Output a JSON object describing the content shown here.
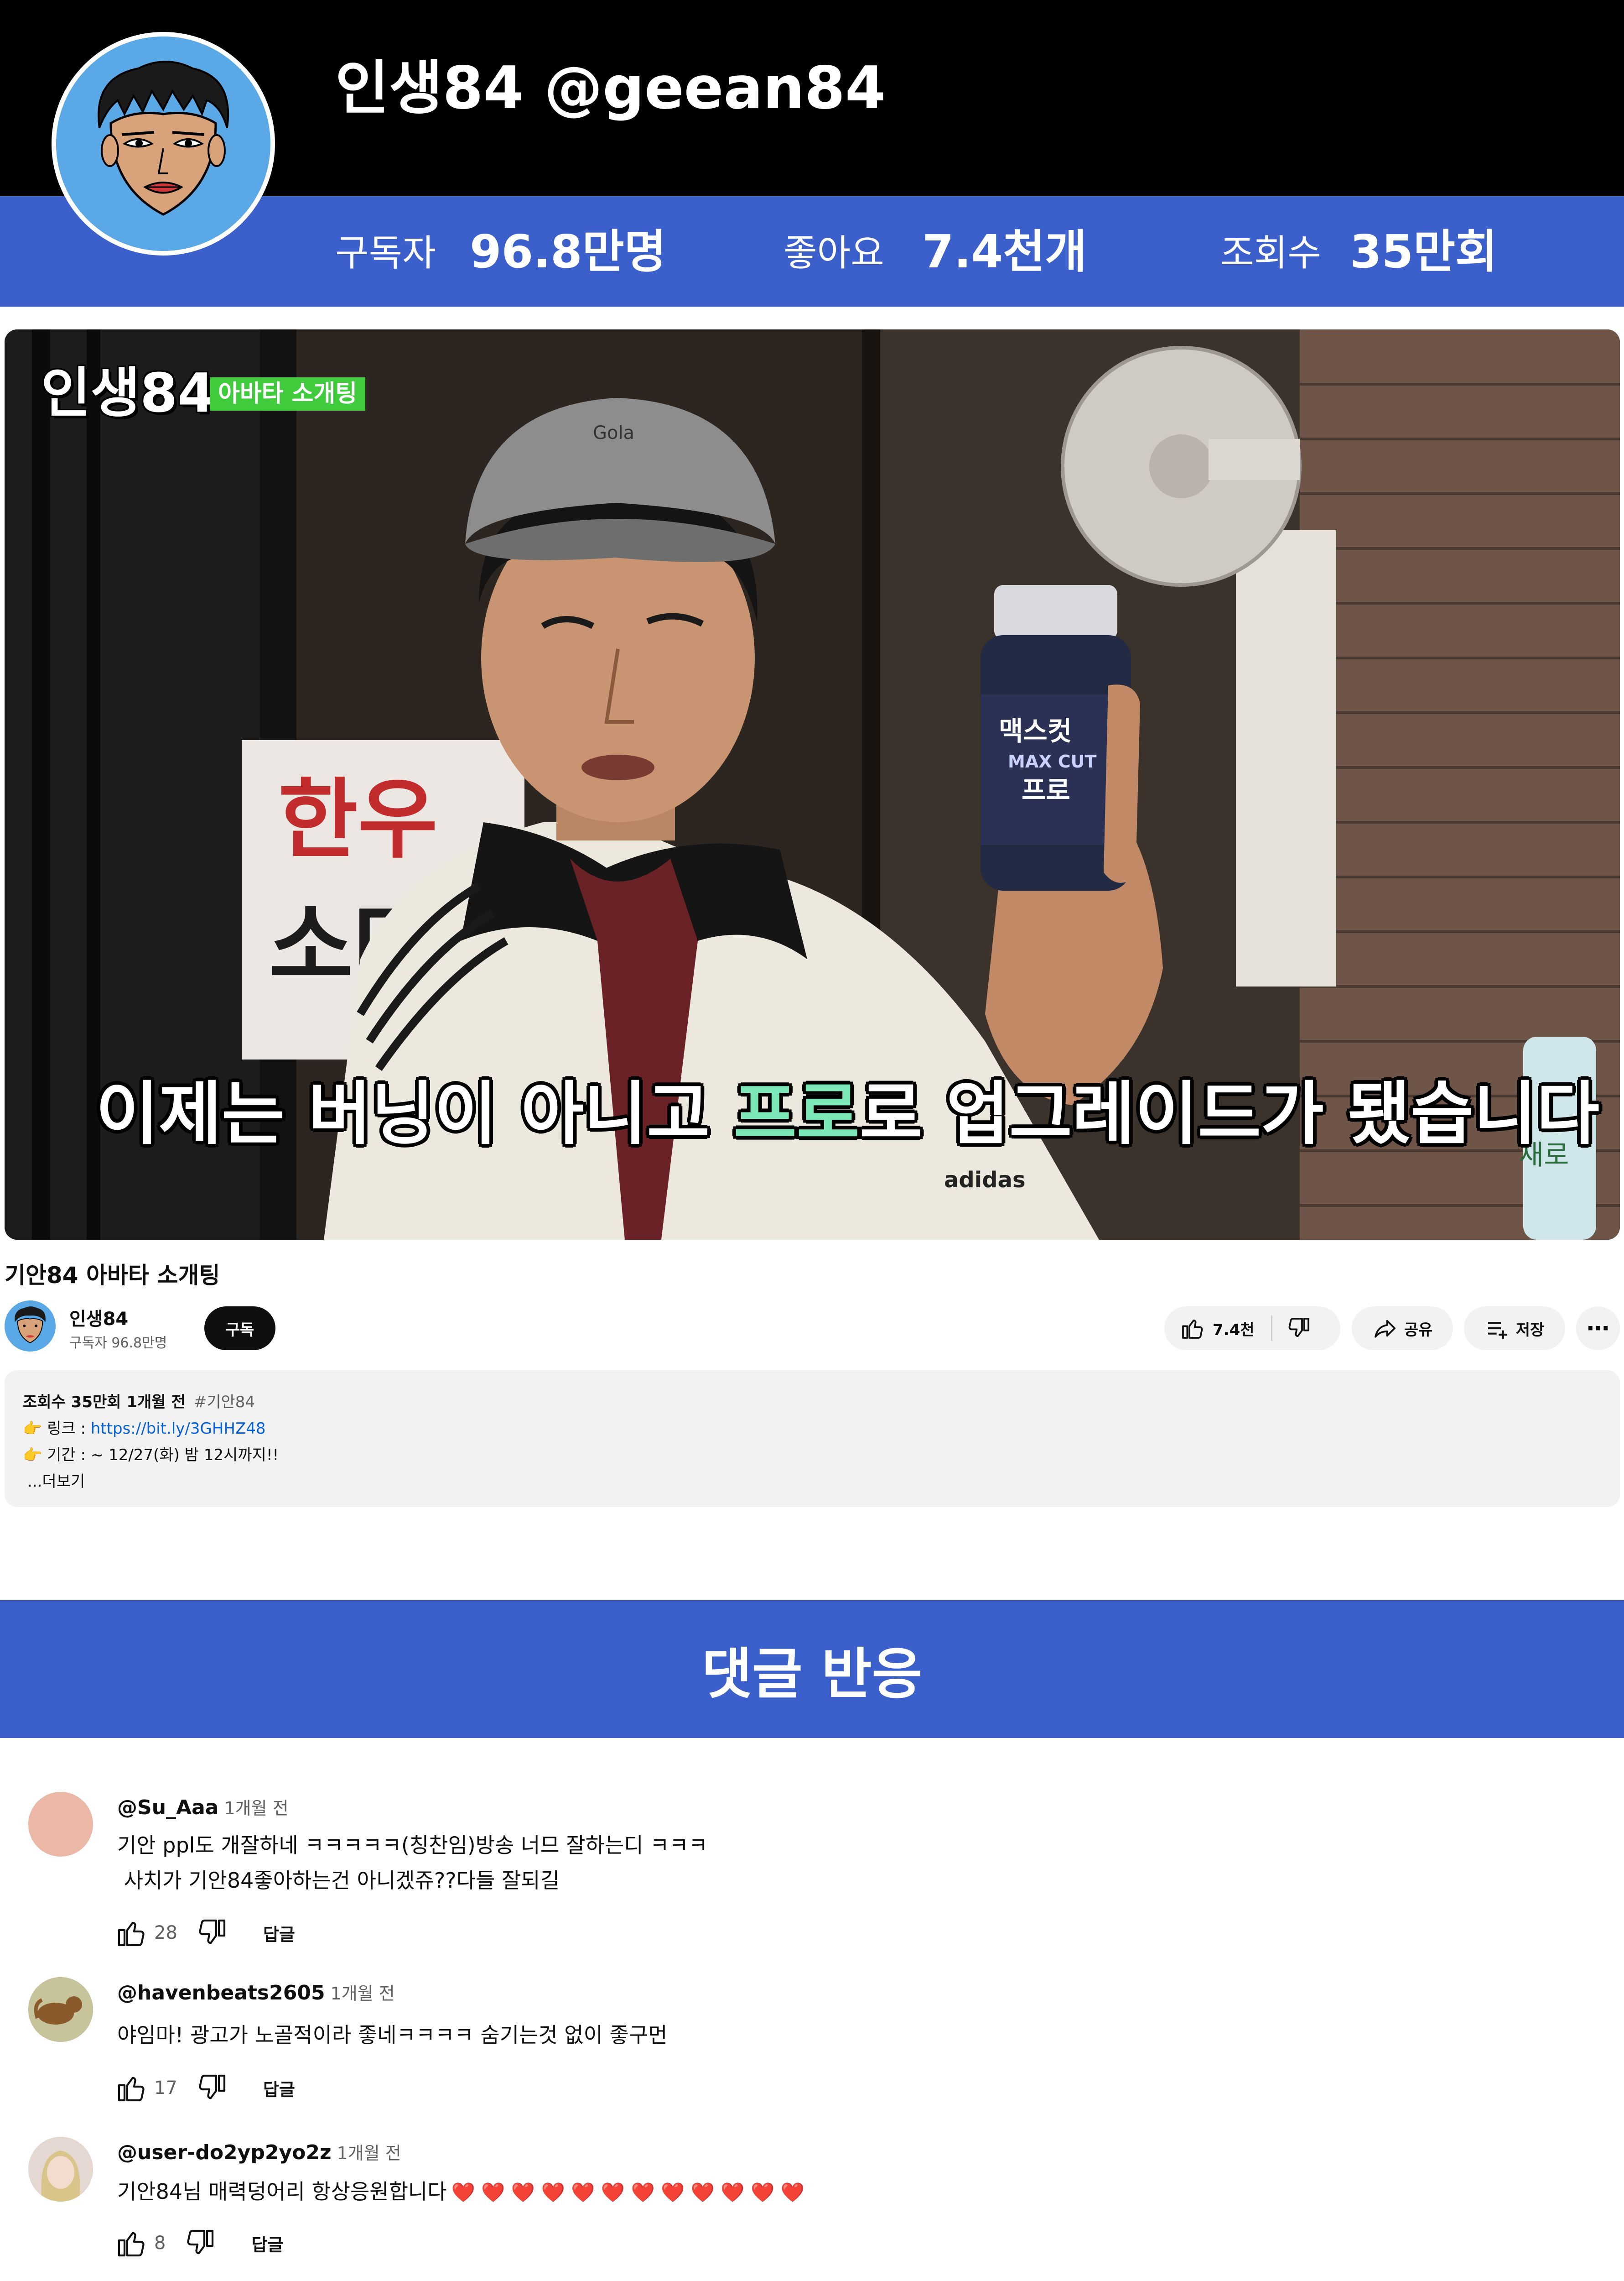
{
  "header": {
    "channel_title": "인생84 @geean84",
    "stats": [
      {
        "label": "구독자",
        "value": "96.8만명"
      },
      {
        "label": "좋아요",
        "value": "7.4천개"
      },
      {
        "label": "조회수",
        "value": "35만회"
      }
    ]
  },
  "video": {
    "logo": "인생84",
    "tag": "아바타 소개팅",
    "subtitle_before": "이제는 버닝이 아니고 ",
    "subtitle_highlight": "프로",
    "subtitle_after": "로 업그레이드가 됐습니다",
    "product_label_1": "맥스컷",
    "product_label_2": "MAX CUT",
    "product_label_3": "프로",
    "shirt_brand": "adidas",
    "sign_left": "한우",
    "sign_left_2": "소머",
    "sign_right": "새로"
  },
  "meta": {
    "title": "기안84 아바타 소개팅",
    "channel_name": "인생84",
    "subscribers": "구독자 96.8만명",
    "subscribe_label": "구독",
    "like_count": "7.4천",
    "share_label": "공유",
    "save_label": "저장",
    "more_label": "⋯"
  },
  "description": {
    "views_line": "조회수 35만회  1개월 전",
    "hashtag": "#기안84",
    "link_label": "👉 링크 : ",
    "link_url": "https://bit.ly/3GHHZ48",
    "period_line": "👉 기간 :  ~ 12/27(화) 밤 12시까지!!",
    "more": "...더보기"
  },
  "comments_banner": "댓글 반응",
  "comments": [
    {
      "author": "@Su_Aaa",
      "time": "1개월 전",
      "lines": [
        "기안 ppl도 개잘하네 ㅋㅋㅋㅋㅋ(칭찬임)방송 너므 잘하는디 ㅋㅋㅋ",
        " 사치가 기안84좋아하는건 아니겠쥬??다들 잘되길"
      ],
      "likes": "28",
      "reply_label": "답글",
      "avatar_color": "#ebb8a8"
    },
    {
      "author": "@havenbeats2605",
      "time": "1개월 전",
      "lines": [
        "야임마! 광고가 노골적이라 좋네ㅋㅋㅋㅋ 숨기는것 없이 좋구먼"
      ],
      "likes": "17",
      "reply_label": "답글",
      "avatar_color": "#8d8f6a"
    },
    {
      "author": "@user-do2yp2yo2z",
      "time": "1개월 전",
      "lines": [
        "기안84님 매력덩어리 항상응원합니다"
      ],
      "hearts": "❤️ ❤️ ❤️ ❤️ ❤️ ❤️ ❤️ ❤️ ❤️ ❤️ ❤️ ❤️",
      "likes": "8",
      "reply_label": "답글",
      "avatar_color": "#d8c7c2"
    }
  ],
  "colors": {
    "brand_blue": "#3b5fcb",
    "header_black": "#000000",
    "subtitle_highlight": "#7be7b6",
    "tag_green": "#3fcb3b",
    "link_blue": "#065fd4"
  },
  "icons": [
    "cartoon-avatar-icon",
    "like-icon",
    "dislike-icon",
    "share-icon",
    "save-icon",
    "more-icon"
  ]
}
